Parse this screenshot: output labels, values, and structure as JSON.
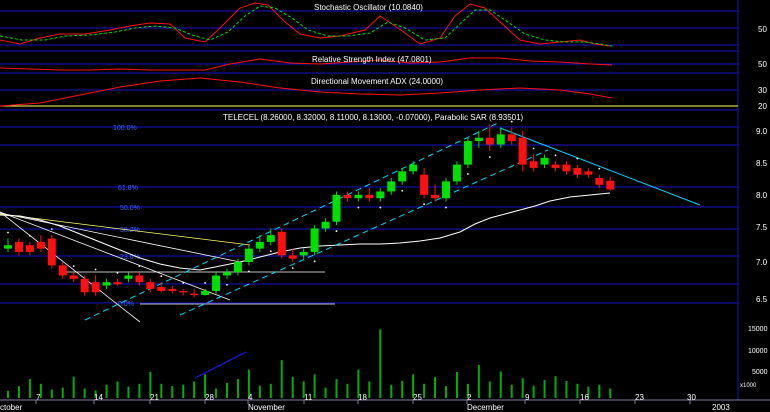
{
  "panels": {
    "stochastic": {
      "title": "Stochastic Oscillator (10.0840)",
      "ticks": [
        "50"
      ]
    },
    "rsi": {
      "title": "Relative Strength Index (47.0801)",
      "ticks": [
        "50"
      ]
    },
    "adx": {
      "title": "Directional Movement ADX (24.0000)",
      "ticks": [
        "30",
        "20"
      ]
    },
    "price": {
      "title": "TELECEL (8.26000, 8.32000, 8.11000, 8.13000, -0.07000), Parabolic SAR (8.93501)",
      "fib_labels": [
        "100.0%",
        "61.8%",
        "50.0%",
        "38.2%",
        "23.6%",
        "0.0%"
      ],
      "ticks": [
        "9.0",
        "8.5",
        "8.0",
        "7.5",
        "7.0",
        "6.5"
      ]
    },
    "volume": {
      "ticks": [
        "15000",
        "10000",
        "5000",
        "x1000"
      ]
    }
  },
  "xaxis": {
    "day_labels": [
      "7",
      "14",
      "21",
      "28",
      "4",
      "11",
      "18",
      "25",
      "2",
      "9",
      "16",
      "23",
      "30"
    ],
    "month_labels": [
      "ctober",
      "November",
      "December",
      "2003"
    ]
  },
  "colors": {
    "up": "#00e000",
    "down": "#ff1010",
    "grid": "#1414c8",
    "channel": "#00d8ff",
    "fan": "#ffffff",
    "yellow": "#ffff66"
  },
  "chart_data": {
    "type": "candlestick",
    "title": "TELECEL (8.26000, 8.32000, 8.11000, 8.13000, -0.07000), Parabolic SAR (8.93501)",
    "y_range": [
      6.5,
      9.1
    ],
    "candles": [
      {
        "o": 7.25,
        "h": 7.4,
        "l": 7.2,
        "c": 7.3
      },
      {
        "o": 7.35,
        "h": 7.4,
        "l": 7.15,
        "c": 7.2
      },
      {
        "o": 7.3,
        "h": 7.35,
        "l": 7.15,
        "c": 7.2
      },
      {
        "o": 7.35,
        "h": 7.45,
        "l": 7.2,
        "c": 7.25
      },
      {
        "o": 7.4,
        "h": 7.45,
        "l": 6.95,
        "c": 7.0
      },
      {
        "o": 7.0,
        "h": 7.05,
        "l": 6.8,
        "c": 6.85
      },
      {
        "o": 6.85,
        "h": 6.9,
        "l": 6.75,
        "c": 6.8
      },
      {
        "o": 6.8,
        "h": 6.85,
        "l": 6.55,
        "c": 6.6
      },
      {
        "o": 6.75,
        "h": 6.85,
        "l": 6.55,
        "c": 6.6
      },
      {
        "o": 6.7,
        "h": 6.8,
        "l": 6.65,
        "c": 6.75
      },
      {
        "o": 6.75,
        "h": 6.8,
        "l": 6.7,
        "c": 6.72
      },
      {
        "o": 6.8,
        "h": 6.9,
        "l": 6.75,
        "c": 6.85
      },
      {
        "o": 6.85,
        "h": 6.9,
        "l": 6.7,
        "c": 6.75
      },
      {
        "o": 6.75,
        "h": 6.8,
        "l": 6.6,
        "c": 6.65
      },
      {
        "o": 6.68,
        "h": 6.75,
        "l": 6.6,
        "c": 6.62
      },
      {
        "o": 6.65,
        "h": 6.7,
        "l": 6.58,
        "c": 6.62
      },
      {
        "o": 6.62,
        "h": 6.65,
        "l": 6.55,
        "c": 6.6
      },
      {
        "o": 6.58,
        "h": 6.65,
        "l": 6.52,
        "c": 6.56
      },
      {
        "o": 6.56,
        "h": 6.65,
        "l": 6.55,
        "c": 6.62
      },
      {
        "o": 6.62,
        "h": 6.9,
        "l": 6.58,
        "c": 6.85
      },
      {
        "o": 6.85,
        "h": 6.95,
        "l": 6.8,
        "c": 6.9
      },
      {
        "o": 6.9,
        "h": 7.1,
        "l": 6.85,
        "c": 7.05
      },
      {
        "o": 7.05,
        "h": 7.3,
        "l": 7.0,
        "c": 7.25
      },
      {
        "o": 7.25,
        "h": 7.45,
        "l": 7.2,
        "c": 7.35
      },
      {
        "o": 7.35,
        "h": 7.55,
        "l": 7.3,
        "c": 7.45
      },
      {
        "o": 7.5,
        "h": 7.55,
        "l": 7.1,
        "c": 7.15
      },
      {
        "o": 7.15,
        "h": 7.25,
        "l": 7.05,
        "c": 7.1
      },
      {
        "o": 7.15,
        "h": 7.25,
        "l": 7.1,
        "c": 7.2
      },
      {
        "o": 7.2,
        "h": 7.6,
        "l": 7.15,
        "c": 7.55
      },
      {
        "o": 7.55,
        "h": 7.7,
        "l": 7.5,
        "c": 7.65
      },
      {
        "o": 7.65,
        "h": 8.1,
        "l": 7.6,
        "c": 8.05
      },
      {
        "o": 8.05,
        "h": 8.1,
        "l": 7.95,
        "c": 8.0
      },
      {
        "o": 8.0,
        "h": 8.1,
        "l": 7.95,
        "c": 8.05
      },
      {
        "o": 8.05,
        "h": 8.15,
        "l": 7.95,
        "c": 8.0
      },
      {
        "o": 8.0,
        "h": 8.15,
        "l": 7.95,
        "c": 8.1
      },
      {
        "o": 8.1,
        "h": 8.3,
        "l": 8.05,
        "c": 8.25
      },
      {
        "o": 8.25,
        "h": 8.45,
        "l": 8.2,
        "c": 8.4
      },
      {
        "o": 8.4,
        "h": 8.55,
        "l": 8.35,
        "c": 8.5
      },
      {
        "o": 8.35,
        "h": 8.45,
        "l": 8.0,
        "c": 8.05
      },
      {
        "o": 8.05,
        "h": 8.2,
        "l": 7.95,
        "c": 8.0
      },
      {
        "o": 8.0,
        "h": 8.3,
        "l": 7.95,
        "c": 8.25
      },
      {
        "o": 8.25,
        "h": 8.55,
        "l": 8.2,
        "c": 8.5
      },
      {
        "o": 8.5,
        "h": 8.9,
        "l": 8.45,
        "c": 8.85
      },
      {
        "o": 8.85,
        "h": 9.0,
        "l": 8.75,
        "c": 8.9
      },
      {
        "o": 8.9,
        "h": 9.1,
        "l": 8.7,
        "c": 8.8
      },
      {
        "o": 8.8,
        "h": 9.05,
        "l": 8.75,
        "c": 8.95
      },
      {
        "o": 8.95,
        "h": 9.05,
        "l": 8.8,
        "c": 8.85
      },
      {
        "o": 8.9,
        "h": 9.0,
        "l": 8.4,
        "c": 8.5
      },
      {
        "o": 8.55,
        "h": 8.65,
        "l": 8.4,
        "c": 8.45
      },
      {
        "o": 8.5,
        "h": 8.65,
        "l": 8.45,
        "c": 8.6
      },
      {
        "o": 8.5,
        "h": 8.55,
        "l": 8.4,
        "c": 8.45
      },
      {
        "o": 8.5,
        "h": 8.55,
        "l": 8.35,
        "c": 8.4
      },
      {
        "o": 8.45,
        "h": 8.5,
        "l": 8.3,
        "c": 8.35
      },
      {
        "o": 8.4,
        "h": 8.45,
        "l": 8.3,
        "c": 8.35
      },
      {
        "o": 8.3,
        "h": 8.35,
        "l": 8.15,
        "c": 8.2
      },
      {
        "o": 8.26,
        "h": 8.32,
        "l": 8.11,
        "c": 8.13
      }
    ],
    "volume": [
      1500,
      2500,
      4000,
      3000,
      1800,
      2200,
      4500,
      2000,
      1600,
      2800,
      3500,
      2400,
      3000,
      5500,
      3000,
      2500,
      2800,
      3500,
      5000,
      2000,
      3200,
      4000,
      6000,
      2600,
      3000,
      8000,
      4500,
      3500,
      5000,
      2200,
      4000,
      3000,
      6000,
      3500,
      14500,
      2800,
      3600,
      5000,
      3000,
      4400,
      2500,
      5500,
      3000,
      7000,
      3500,
      5600,
      2800,
      4200,
      2600,
      3800,
      4600,
      3600,
      3000,
      2400,
      2800,
      2000
    ]
  }
}
